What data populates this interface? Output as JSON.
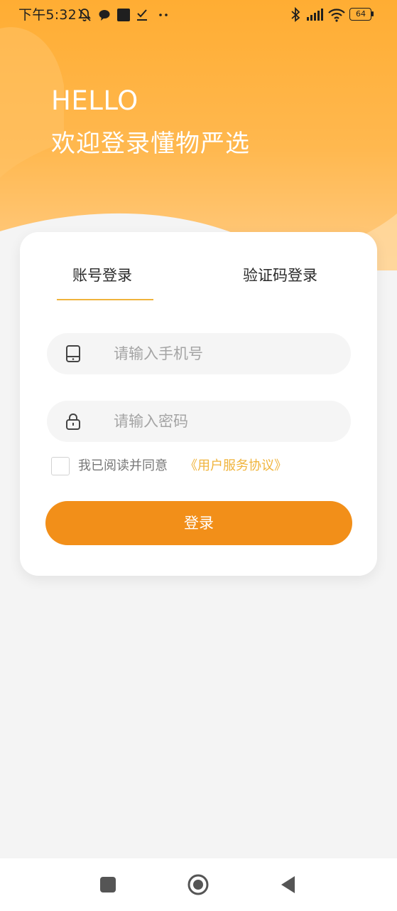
{
  "status_bar": {
    "time": "下午5:32",
    "battery": "64",
    "icons": [
      "bell-off-icon",
      "chat-bubble-icon",
      "app-square-icon",
      "checklist-icon",
      "more-dots-icon",
      "bluetooth-icon",
      "signal-icon",
      "wifi-icon",
      "battery-icon"
    ]
  },
  "header": {
    "hello": "HELLO",
    "welcome": "欢迎登录懂物严选"
  },
  "tabs": [
    {
      "label": "账号登录",
      "active": true
    },
    {
      "label": "验证码登录",
      "active": false
    }
  ],
  "form": {
    "phone": {
      "placeholder": "请输入手机号",
      "value": "",
      "icon": "phone-icon"
    },
    "password": {
      "placeholder": "请输入密码",
      "value": "",
      "icon": "lock-icon"
    },
    "agreement": {
      "checked": false,
      "text": "我已阅读并同意",
      "link": "《用户服务协议》"
    },
    "login_label": "登录"
  },
  "nav_bar": {
    "icons": [
      "recent-apps-icon",
      "home-icon",
      "back-icon"
    ]
  },
  "colors": {
    "accent": "#f28f19",
    "link": "#f0b43c",
    "header_gradient_top": "#ffad33",
    "header_gradient_bottom": "#ffcc85",
    "background": "#f4f4f4"
  }
}
